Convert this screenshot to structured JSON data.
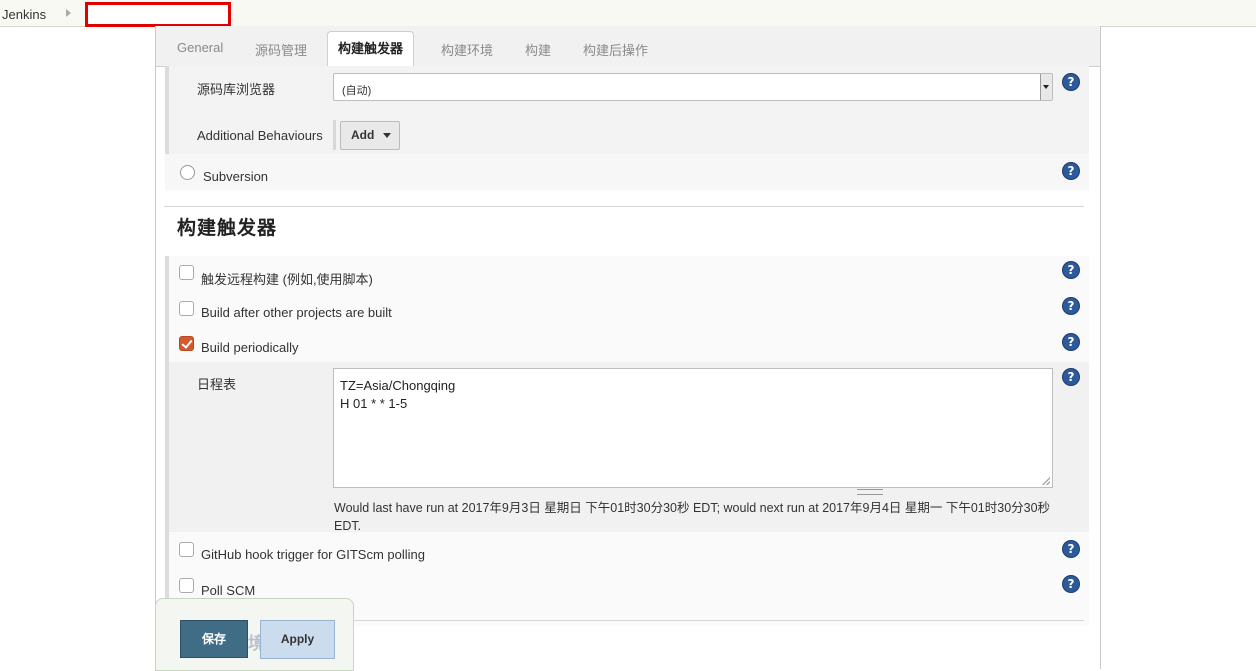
{
  "breadcrumb": {
    "root": "Jenkins"
  },
  "tabs": [
    "General",
    "源码管理",
    "构建触发器",
    "构建环境",
    "构建",
    "构建后操作"
  ],
  "active_tab": "构建触发器",
  "scm": {
    "browser_label": "源码库浏览器",
    "browser_value": "(自动)",
    "behaviours_label": "Additional Behaviours",
    "add_button": "Add",
    "subversion_label": "Subversion"
  },
  "triggers": {
    "title": "构建触发器",
    "remote_label": "触发远程构建 (例如,使用脚本)",
    "after_other_label": "Build after other projects are built",
    "periodic_label": "Build periodically",
    "periodic_checked": true,
    "schedule_label": "日程表",
    "schedule_lines": [
      "TZ=Asia/Chongqing",
      "H 01 * * 1-5"
    ],
    "schedule_note": "Would last have run at 2017年9月3日 星期日 下午01时30分30秒 EDT; would next run at 2017年9月4日 星期一 下午01时30分30秒 EDT.",
    "github_hook_label": "GitHub hook trigger for GITScm polling",
    "poll_scm_label": "Poll SCM"
  },
  "help_icon_glyph": "?",
  "buttons": {
    "save": "保存",
    "apply": "Apply"
  },
  "colors": {
    "save_bg": "#406c86",
    "apply_bg": "#cbdcee",
    "checkbox_checked": "#d35a2e",
    "help_icon": "#2d5a9a"
  }
}
